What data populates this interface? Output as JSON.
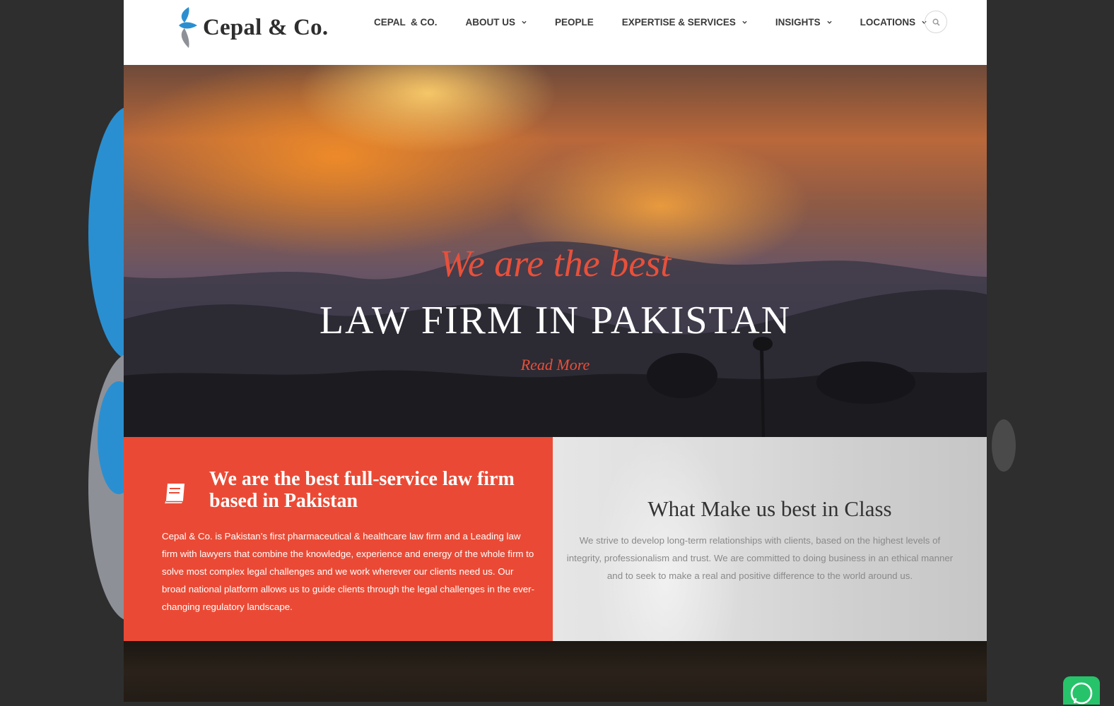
{
  "brand": {
    "name": "Cepal & Co.",
    "accent": "#ea4a35",
    "logo_blue": "#2a8fd0",
    "logo_grey": "#8e9097"
  },
  "nav": {
    "items": [
      {
        "label": "CEPAL  & CO.",
        "dropdown": false
      },
      {
        "label": "ABOUT US",
        "dropdown": true
      },
      {
        "label": "PEOPLE",
        "dropdown": false
      },
      {
        "label": "EXPERTISE & SERVICES",
        "dropdown": true
      },
      {
        "label": "INSIGHTS",
        "dropdown": true
      },
      {
        "label": "LOCATIONS",
        "dropdown": true
      }
    ],
    "search_icon": "search-icon"
  },
  "hero": {
    "subtitle": "We are the best",
    "title": "LAW FIRM IN PAKISTAN",
    "link": "Read More"
  },
  "intro": {
    "icon": "book-icon",
    "title": "We are the best full-service law firm based in Pakistan",
    "body": "Cepal & Co. is Pakistan’s first pharmaceutical & healthcare law firm and a Leading law firm with lawyers that combine the knowledge, experience and energy of the whole firm to solve most complex legal challenges and we work wherever our clients need us. Our broad national platform allows us to guide clients through the legal challenges in the ever-changing regulatory landscape."
  },
  "class": {
    "title": "What Make us best in Class",
    "body": "We strive to develop long-term relationships with clients, based on the highest levels of integrity, professionalism and trust. We are committed to doing business in an ethical manner and to seek to make a real and positive difference to the world around us."
  },
  "widgets": {
    "whatsapp_icon": "whatsapp-icon"
  }
}
